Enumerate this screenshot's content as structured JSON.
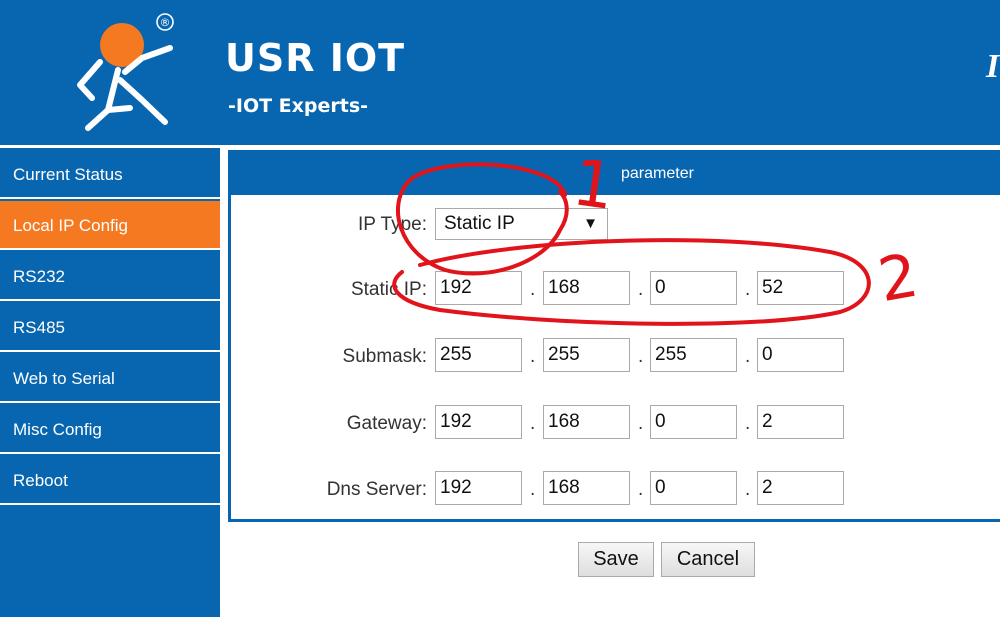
{
  "header": {
    "brand_title": "USR IOT",
    "brand_subtitle": "-IOT Experts-",
    "registered_mark": "®",
    "edge_text": "I"
  },
  "sidebar": {
    "items": [
      {
        "label": "Current Status",
        "active": false
      },
      {
        "label": "Local IP Config",
        "active": true
      },
      {
        "label": "RS232",
        "active": false
      },
      {
        "label": "RS485",
        "active": false
      },
      {
        "label": "Web to Serial",
        "active": false
      },
      {
        "label": "Misc Config",
        "active": false
      },
      {
        "label": "Reboot",
        "active": false
      }
    ]
  },
  "panel": {
    "title": "parameter",
    "ip_type": {
      "label": "IP Type:",
      "value": "Static IP"
    },
    "static_ip": {
      "label": "Static IP:",
      "octets": [
        "192",
        "168",
        "0",
        "52"
      ]
    },
    "submask": {
      "label": "Submask:",
      "octets": [
        "255",
        "255",
        "255",
        "0"
      ]
    },
    "gateway": {
      "label": "Gateway:",
      "octets": [
        "192",
        "168",
        "0",
        "2"
      ]
    },
    "dns_server": {
      "label": "Dns Server:",
      "octets": [
        "192",
        "168",
        "0",
        "2"
      ]
    },
    "dot": "."
  },
  "buttons": {
    "save": "Save",
    "cancel": "Cancel"
  },
  "annotations": {
    "mark_1": "1",
    "mark_2": "2",
    "ink_color": "#e0141a"
  },
  "colors": {
    "brand_blue": "#0866b0",
    "active_orange": "#f47920"
  }
}
